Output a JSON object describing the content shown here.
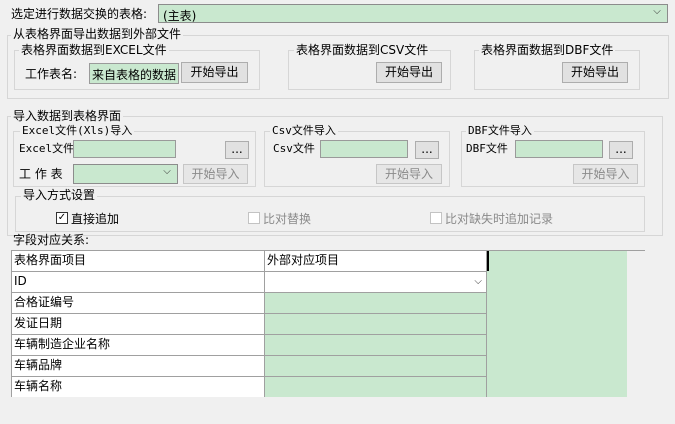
{
  "table_select": {
    "label": "选定进行数据交换的表格:",
    "value": "(主表)"
  },
  "export_section": {
    "title": "从表格界面导出数据到外部文件",
    "excel": {
      "title": "表格界面数据到EXCEL文件",
      "sheet_label": "工作表名:",
      "sheet_value": "来自表格的数据",
      "button": "开始导出"
    },
    "csv": {
      "title": "表格界面数据到CSV文件",
      "button": "开始导出"
    },
    "dbf": {
      "title": "表格界面数据到DBF文件",
      "button": "开始导出"
    }
  },
  "import_section": {
    "title": "导入数据到表格界面",
    "excel": {
      "title": "Excel文件(Xls)导入",
      "file_label": "Excel文件",
      "file_value": "",
      "browse": "...",
      "sheet_label": "工 作 表",
      "sheet_value": "",
      "button": "开始导入"
    },
    "csv": {
      "title": "Csv文件导入",
      "file_label": "Csv文件",
      "file_value": "",
      "browse": "...",
      "button": "开始导入"
    },
    "dbf": {
      "title": "DBF文件导入",
      "file_label": "DBF文件",
      "file_value": "",
      "browse": "...",
      "button": "开始导入"
    },
    "mode": {
      "title": "导入方式设置",
      "options": [
        {
          "label": "直接追加",
          "checked": true,
          "enabled": true
        },
        {
          "label": "比对替换",
          "checked": false,
          "enabled": false
        },
        {
          "label": "比对缺失时追加记录",
          "checked": false,
          "enabled": false
        }
      ]
    }
  },
  "mapping": {
    "label": "字段对应关系:",
    "columns": [
      "表格界面项目",
      "外部对应项目"
    ],
    "rows": [
      {
        "field": "ID",
        "external": ""
      },
      {
        "field": "合格证编号",
        "external": ""
      },
      {
        "field": "发证日期",
        "external": ""
      },
      {
        "field": "车辆制造企业名称",
        "external": ""
      },
      {
        "field": "车辆品牌",
        "external": ""
      },
      {
        "field": "车辆名称",
        "external": ""
      }
    ]
  },
  "icons": {
    "dropdown": "chevron-down-icon",
    "check": "checkmark-icon"
  },
  "colors": {
    "field_bg": "#c9e8cf",
    "window_bg": "#f0f0f0"
  }
}
